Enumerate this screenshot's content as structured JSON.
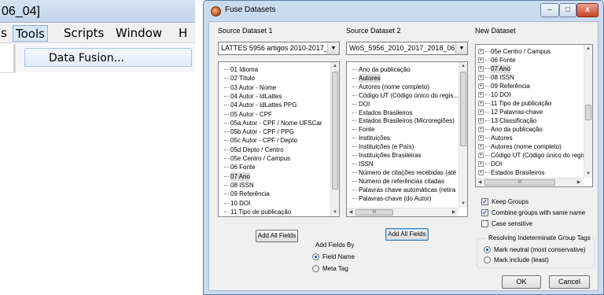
{
  "background_app": {
    "title_fragment": "06_04]",
    "menu": [
      {
        "id": "s",
        "label": "s"
      },
      {
        "id": "tools",
        "label": "Tools"
      },
      {
        "id": "scripts",
        "label": "Scripts"
      },
      {
        "id": "window",
        "label": "Window"
      },
      {
        "id": "h",
        "label": "H"
      }
    ],
    "dropdown_item": "Data Fusion..."
  },
  "dialog": {
    "title": "Fuse Datasets",
    "caption_buttons": {
      "minimize": "–",
      "maximize": "□",
      "close": "x"
    },
    "source1": {
      "label": "Source Dataset 1",
      "combo_value": "LATTES 5956 artigos 2010-2017_2018",
      "items": [
        "01 Idioma",
        "02 Título",
        "03 Autor - Nome",
        "04 Autor - IdLattes",
        "04 Autor - IdLattes PPG",
        "05 Autor - CPF",
        "05a Autor - CPF / Nome UFSCar",
        "05b Autor - CPF / PPG",
        "05c Autor - CPF / Depto",
        "05d Depto / Centro",
        "05e Centro / Campus",
        "06 Fonte",
        "07 Ano",
        "08 ISSN",
        "09 Referência",
        "10 DOI",
        "11 Tipo de publicação"
      ],
      "selected_index": 12,
      "add_all_label": "Add All Fields"
    },
    "source2": {
      "label": "Source Dataset 2",
      "combo_value": "WoS_5956_2010_2017_2018_06_04",
      "items": [
        "Ano da publicação",
        "Autores",
        "Autores (nome completo)",
        "Código UT (Código único do regis...",
        "DOI",
        "Estados Brasileiros",
        "Estados Brasileiros (Microregiões)",
        "Fonte",
        "Instituições",
        "Instituições (e País)",
        "Instituições Brasileiras",
        "ISSN",
        "Número de citações recebidas (até",
        "Número de referências citadas",
        "Palavras chave automáticas (retira",
        "Palavras-chave (do Autor)"
      ],
      "selected_index": 1,
      "add_all_label": "Add All Fields"
    },
    "new_dataset": {
      "label": "New Dataset",
      "items": [
        "05e Centro / Campus",
        "06 Fonte",
        "07 Ano",
        "08 ISSN",
        "09 Referência",
        "10 DOI",
        "11 Tipo de publicação",
        "12 Palavras-chave",
        "13 Classificação",
        "Ano da publicação",
        "Autores",
        "Autores (nome completo)",
        "Código UT (Código único do regis...",
        "DOI",
        "Estados Brasileiros"
      ],
      "selected_index": 2
    },
    "add_fields_by": {
      "title": "Add Fields By",
      "options": [
        "Field Name",
        "Meta Tag"
      ],
      "selected": "Field Name"
    },
    "options": {
      "keep_groups": {
        "label": "Keep Groups",
        "checked": true
      },
      "combine_groups": {
        "label": "Combine groups with same name",
        "checked": true
      },
      "case_sensitive": {
        "label": "Case sensitive",
        "checked": false
      }
    },
    "indeterminate": {
      "title": "Resolving Indeterminate Group Tags",
      "options": [
        "Mark neutral (most conservative)",
        "Mark include (least)"
      ],
      "selected": "Mark neutral (most conservative)"
    },
    "ok_label": "OK",
    "cancel_label": "Cancel",
    "hscroll_grip": "III"
  }
}
